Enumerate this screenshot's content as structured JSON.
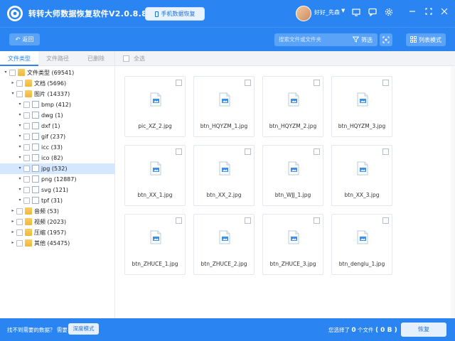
{
  "titlebar": {
    "app_title": "转转大师数据恢复软件V2.0.8.8",
    "phone_button": "手机数据恢复",
    "username": "好好_先森"
  },
  "toolbar": {
    "back_label": "返回",
    "search_placeholder": "搜索文件或文件夹",
    "filter_label": "筛选",
    "list_mode_label": "列表模式"
  },
  "sidebar": {
    "tabs": [
      {
        "label": "文件类型",
        "active": true
      },
      {
        "label": "文件路径",
        "active": false
      },
      {
        "label": "已删除",
        "active": false
      }
    ],
    "tree": [
      {
        "label": "文件类型 (69541)",
        "level": 0,
        "expanded": true,
        "icon": "folder-icon"
      },
      {
        "label": "文档 (5696)",
        "level": 1,
        "expanded": false,
        "icon": "folder-icon"
      },
      {
        "label": "图片 (14337)",
        "level": 1,
        "expanded": true,
        "icon": "folder-icon"
      },
      {
        "label": "bmp (412)",
        "level": 2,
        "expanded": true,
        "icon": "bmp-file-icon"
      },
      {
        "label": "dwg (1)",
        "level": 2,
        "expanded": true,
        "icon": "dwg-file-icon"
      },
      {
        "label": "dxf (1)",
        "level": 2,
        "expanded": true,
        "icon": "dxf-file-icon"
      },
      {
        "label": "gif (237)",
        "level": 2,
        "expanded": true,
        "icon": "gif-file-icon"
      },
      {
        "label": "icc (33)",
        "level": 2,
        "expanded": true,
        "icon": "icc-file-icon"
      },
      {
        "label": "ico (82)",
        "level": 2,
        "expanded": true,
        "icon": "ico-file-icon"
      },
      {
        "label": "jpg (532)",
        "level": 2,
        "expanded": true,
        "icon": "jpg-file-icon",
        "selected": true
      },
      {
        "label": "png (12887)",
        "level": 2,
        "expanded": true,
        "icon": "png-file-icon"
      },
      {
        "label": "svg (121)",
        "level": 2,
        "expanded": true,
        "icon": "svg-file-icon"
      },
      {
        "label": "tpf (31)",
        "level": 2,
        "expanded": true,
        "icon": "tpf-file-icon"
      },
      {
        "label": "音频 (53)",
        "level": 1,
        "expanded": false,
        "icon": "folder-icon"
      },
      {
        "label": "视频 (2023)",
        "level": 1,
        "expanded": false,
        "icon": "folder-icon"
      },
      {
        "label": "压缩 (1957)",
        "level": 1,
        "expanded": false,
        "icon": "folder-icon"
      },
      {
        "label": "其他 (45475)",
        "level": 1,
        "expanded": false,
        "icon": "folder-icon"
      }
    ]
  },
  "main": {
    "select_all_label": "全选",
    "files": [
      "pic_XZ_2.jpg",
      "btn_HQYZM_1.jpg",
      "btn_HQYZM_2.jpg",
      "btn_HQYZM_3.jpg",
      "btn_XX_1.jpg",
      "btn_XX_2.jpg",
      "btn_WJJ_1.jpg",
      "btn_XX_3.jpg",
      "btn_ZHUCE_1.jpg",
      "btn_ZHUCE_2.jpg",
      "btn_ZHUCE_3.jpg",
      "btn_denglu_1.jpg"
    ]
  },
  "bottombar": {
    "hint": "找不到需要的数据？ 需要",
    "deep_mode_label": "深度模式",
    "selected_prefix": "您选择了",
    "selected_count": "0",
    "selected_unit": "个文件",
    "selected_size": "( 0 B )",
    "recover_label": "恢复"
  },
  "colors": {
    "brand_blue": "#2a84f2",
    "selection_blue": "#d4e7ff",
    "folder_yellow": "#f1b73a"
  }
}
